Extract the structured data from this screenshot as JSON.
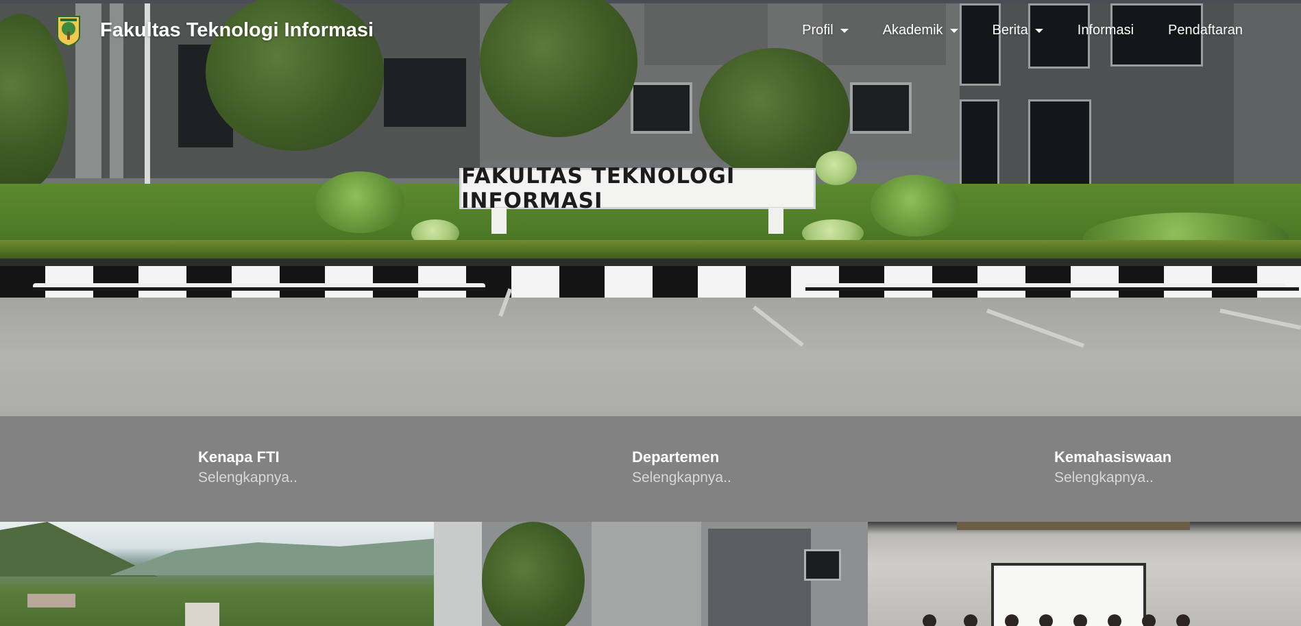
{
  "header": {
    "brand_title": "Fakultas Teknologi Informasi",
    "logo_icon": "university-crest-icon"
  },
  "nav": {
    "items": [
      {
        "label": "Profil",
        "has_dropdown": true
      },
      {
        "label": "Akademik",
        "has_dropdown": true
      },
      {
        "label": "Berita",
        "has_dropdown": true
      },
      {
        "label": "Informasi",
        "has_dropdown": false
      },
      {
        "label": "Pendaftaran",
        "has_dropdown": false
      }
    ]
  },
  "hero": {
    "sign_text": "FAKULTAS TEKNOLOGI INFORMASI"
  },
  "features": [
    {
      "title": "Kenapa FTI",
      "link": "Selengkapnya.."
    },
    {
      "title": "Departemen",
      "link": "Selengkapnya.."
    },
    {
      "title": "Kemahasiswaan",
      "link": "Selengkapnya.."
    }
  ],
  "colors": {
    "band": "#828282",
    "text": "#ffffff",
    "link": "#d8d8d8"
  }
}
